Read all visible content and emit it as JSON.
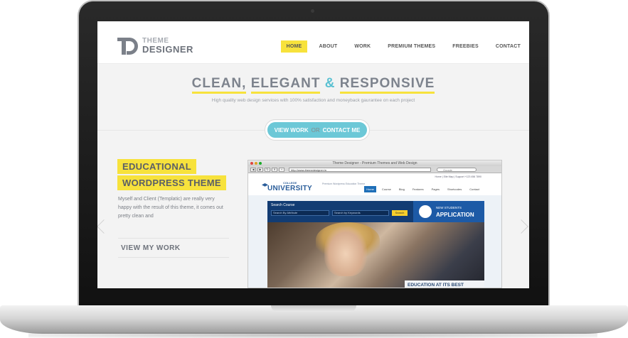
{
  "header": {
    "logo_line1": "THEME",
    "logo_line2": "DESIGNER",
    "nav": [
      "HOME",
      "ABOUT",
      "WORK",
      "PREMIUM THEMES",
      "FREEBIES",
      "CONTACT"
    ],
    "active_nav": "HOME"
  },
  "hero": {
    "title_word1": "CLEAN,",
    "title_word2": "ELEGANT",
    "title_amp": "&",
    "title_word3": "RESPONSIVE",
    "subtitle": "High quality web design services with 100% satisfaction and moneyback gaurantee on each project",
    "cta_left": "VIEW WORK",
    "cta_or": "OR",
    "cta_right": "CONTACT ME"
  },
  "slide": {
    "title_line1": "EDUCATIONAL",
    "title_line2": "WORDPRESS THEME",
    "description": "Myself and Client (Templatic) are really very happy with the result of this theme, it comes out pretty clean and",
    "button": "VIEW MY WORK"
  },
  "browser": {
    "window_title": "Theme Designer - Premium Themes and Web Design",
    "url": "http://www.themedesigner.in",
    "search_placeholder": "Google",
    "site": {
      "college": "COLLEGE",
      "university": "UNIVERSITY",
      "tagline": "Premium Wordpress Education Theme",
      "toplinks": "Home | Site Map | Support    +123 456 7890",
      "nav": [
        "Home",
        "Course",
        "Blog",
        "Features",
        "Pages",
        "Shortcodes",
        "Contact"
      ],
      "search_label": "Search Course",
      "search_attr": "Search By Attribute",
      "search_kw": "Search by Keywords",
      "search_btn": "Search",
      "apply_line1": "NEW STUDENTS",
      "apply_line2": "APPLICATION",
      "caption": "EDUCATION AT ITS BEST"
    }
  },
  "colors": {
    "accent_yellow": "#f7e23c",
    "accent_teal": "#6cc8d7",
    "text_gray": "#7d838d",
    "site_blue": "#123c73"
  }
}
